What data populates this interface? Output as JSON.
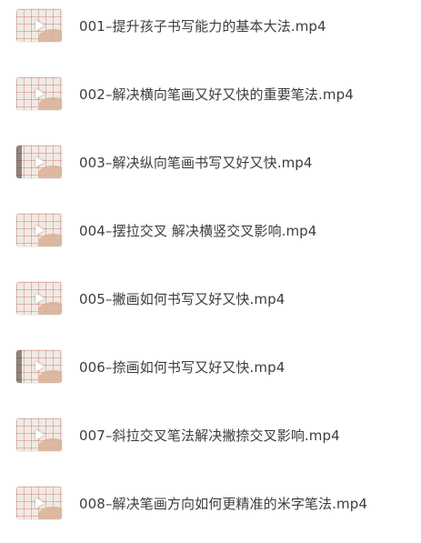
{
  "files": [
    {
      "name": "001–提升孩子书写能力的基本大法.mp4",
      "thumb_icon": "video-thumbnail-icon"
    },
    {
      "name": "002–解决横向笔画又好又快的重要笔法.mp4",
      "thumb_icon": "video-thumbnail-icon"
    },
    {
      "name": "003–解决纵向笔画书写又好又快.mp4",
      "thumb_icon": "video-thumbnail-icon"
    },
    {
      "name": "004–摆拉交叉   解决横竖交叉影响.mp4",
      "thumb_icon": "video-thumbnail-icon"
    },
    {
      "name": "005–撇画如何书写又好又快.mp4",
      "thumb_icon": "video-thumbnail-icon"
    },
    {
      "name": "006–捺画如何书写又好又快.mp4",
      "thumb_icon": "video-thumbnail-icon"
    },
    {
      "name": "007–斜拉交叉笔法解决撇捺交叉影响.mp4",
      "thumb_icon": "video-thumbnail-icon"
    },
    {
      "name": "008–解决笔画方向如何更精准的米字笔法.mp4",
      "thumb_icon": "video-thumbnail-icon"
    }
  ]
}
